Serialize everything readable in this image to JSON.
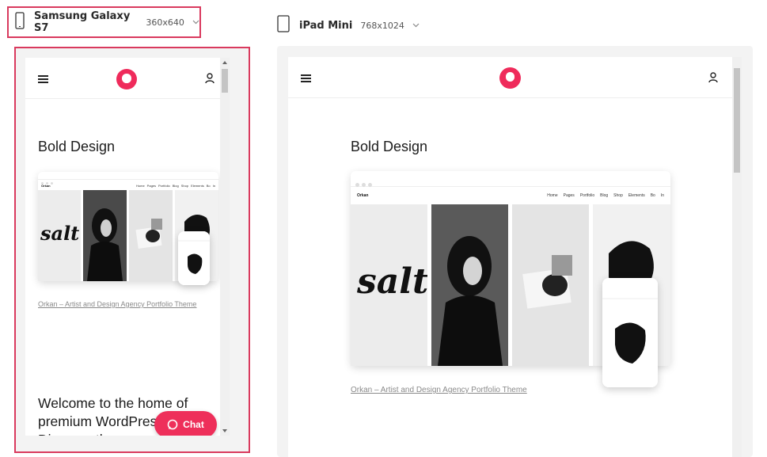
{
  "devices": {
    "phone": {
      "name": "Samsung Galaxy S7",
      "resolution": "360x640"
    },
    "tablet": {
      "name": "iPad Mini",
      "resolution": "768x1024"
    }
  },
  "site": {
    "heading": "Bold Design",
    "caption": "Orkan – Artist and Design Agency Portfolio Theme",
    "welcome": "Welcome to the home of premium WordPress themes. Discover the",
    "chat_label": "Chat"
  },
  "preview": {
    "brand": "Orkan",
    "menu": [
      "Home",
      "Pages",
      "Portfolio",
      "Blog",
      "Shop",
      "Elements",
      "Bo",
      "In"
    ],
    "salt_word": "salt"
  },
  "colors": {
    "accent": "#ee2f5a",
    "selection_border": "#d93a5e"
  },
  "icons": {
    "menu": "hamburger-icon",
    "user": "user-icon",
    "chevron": "chevron-down-icon",
    "chat": "chat-bubble-icon"
  }
}
